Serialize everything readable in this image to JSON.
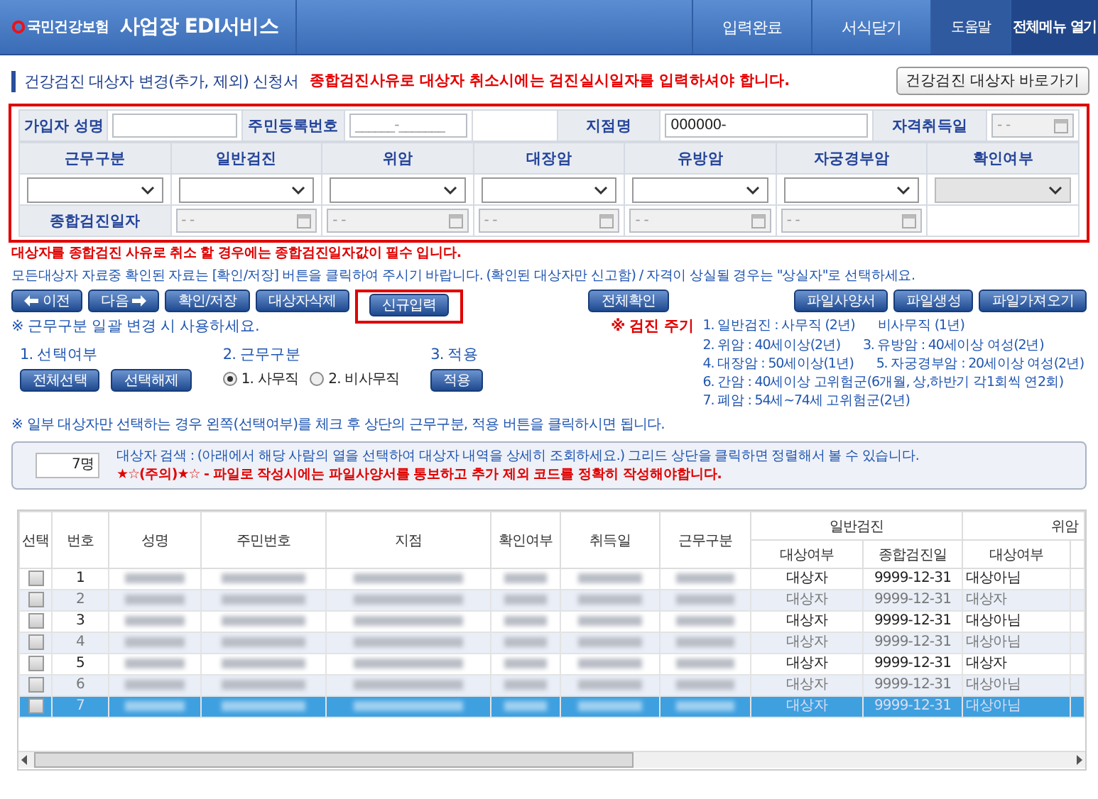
{
  "header": {
    "logo_text": "국민건강보험",
    "title": "사업장 EDI서비스",
    "menu": [
      {
        "label": "입력완료",
        "kind": "main"
      },
      {
        "label": "서식닫기",
        "kind": "main"
      },
      {
        "label": "도움말",
        "kind": "help"
      },
      {
        "label": "전체메뉴 열기",
        "kind": "all"
      }
    ]
  },
  "page": {
    "title": "건강검진 대상자 변경(추가, 제외) 신청서",
    "warning": "종합검진사유로 대상자 취소시에는 검진실시일자를 입력하셔야 합니다.",
    "shortcut_button": "건강검진 대상자 바로가기"
  },
  "form": {
    "fields": [
      {
        "label": "가입자 성명",
        "kind": "text"
      },
      {
        "label": "주민등록번호",
        "kind": "text",
        "placeholder": "______-_______"
      },
      {
        "label": "지점명",
        "kind": "text",
        "value": "000000-"
      },
      {
        "label": "자격취득일",
        "kind": "date",
        "placeholder": "- -",
        "disabled": true
      }
    ],
    "columns": [
      {
        "label": "근무구분",
        "disabled": false
      },
      {
        "label": "일반검진",
        "disabled": false
      },
      {
        "label": "위암",
        "disabled": false
      },
      {
        "label": "대장암",
        "disabled": false
      },
      {
        "label": "유방암",
        "disabled": false
      },
      {
        "label": "자궁경부암",
        "disabled": false
      },
      {
        "label": "확인여부",
        "disabled": true
      }
    ],
    "exam_date": {
      "label": "종합검진일자",
      "fields": [
        {
          "placeholder": "- -",
          "disabled": true
        },
        {
          "placeholder": "- -",
          "disabled": true
        },
        {
          "placeholder": "- -",
          "disabled": true
        },
        {
          "placeholder": "- -",
          "disabled": true
        },
        {
          "placeholder": "- -",
          "disabled": true
        }
      ]
    }
  },
  "notices": [
    {
      "kind": "alert",
      "text": "대상자를 종합검진 사유로 취소 할 경우에는 종합검진일자값이 필수 입니다."
    },
    {
      "kind": "info",
      "text": "모든대상자 자료중 확인된 자료는 [확인/저장] 버튼을 클릭하여 주시기 바랍니다. (확인된 대상자만 신고함) / 자격이 상실될 경우는 \"상실자\"로 선택하세요."
    }
  ],
  "toolbar": {
    "left": [
      {
        "label": "이전",
        "kind": "prev",
        "highlighted": false
      },
      {
        "label": "다음",
        "kind": "next",
        "highlighted": false
      },
      {
        "label": "확인/저장",
        "highlighted": false
      },
      {
        "label": "대상자삭제",
        "highlighted": false
      },
      {
        "label": "신규입력",
        "highlighted": true
      }
    ],
    "center": [
      {
        "label": "전체확인"
      }
    ],
    "right": [
      {
        "label": "파일사양서"
      },
      {
        "label": "파일생성"
      },
      {
        "label": "파일가져오기"
      }
    ]
  },
  "batch": {
    "title": "※ 근무구분 일괄 변경 시 사용하세요.",
    "select": {
      "label": "1. 선택여부",
      "buttons": [
        "전체선택",
        "선택해제"
      ]
    },
    "work_type": {
      "label": "2. 근무구분",
      "options": [
        {
          "label": "1. 사무직",
          "selected": true
        },
        {
          "label": "2. 비사무직",
          "selected": false
        }
      ]
    },
    "apply": {
      "label": "3. 적용",
      "button": "적용"
    },
    "note": "※ 일부 대상자만 선택하는 경우 왼쪽(선택여부)를 체크 후 상단의 근무구분, 적용 버튼을 클릭하시면 됩니다."
  },
  "cycle": {
    "title": "※ 검진 주기",
    "lines": [
      [
        "1. 일반검진 : 사무직 (2년)",
        "비사무직 (1년)"
      ],
      [
        "2. 위암 : 40세이상(2년)",
        "3. 유방암 : 40세이상 여성(2년)"
      ],
      [
        "4. 대장암 : 50세이상(1년)",
        "5. 자궁경부암 : 20세이상 여성(2년)"
      ],
      [
        "6. 간암 : 40세이상 고위험군(6개월, 상,하반기 각1회씩 연2회)"
      ],
      [
        "7. 폐암 : 54세~74세 고위험군(2년)"
      ]
    ]
  },
  "search": {
    "count": "7명",
    "description": "대상자 검색 : (아래에서 해당 사람의 열을 선택하여 대상자 내역을 상세히 조회하세요.) 그리드 상단을 클릭하면 정렬해서 볼 수 있습니다.",
    "caution": "★☆(주의)★☆ - 파일로 작성시에는 파일사양서를 통보하고 추가 제외 코드를 정확히 작성해야합니다."
  },
  "grid": {
    "columns": [
      "선택",
      "번호",
      "성명",
      "주민번호",
      "지점",
      "확인여부",
      "취득일",
      "근무구분"
    ],
    "groups": [
      {
        "label": "일반검진",
        "columns": [
          "대상여부",
          "종합검진일"
        ]
      },
      {
        "label": "위암",
        "columns": [
          "대상여부"
        ]
      }
    ],
    "rows": [
      {
        "checked": false,
        "number": "1",
        "dimmed": false,
        "selected": false,
        "general_target": "대상자",
        "general_date": "9999-12-31",
        "stomach_target": "대상아님"
      },
      {
        "checked": false,
        "number": "2",
        "dimmed": true,
        "selected": false,
        "general_target": "대상자",
        "general_date": "9999-12-31",
        "stomach_target": "대상자"
      },
      {
        "checked": false,
        "number": "3",
        "dimmed": false,
        "selected": false,
        "general_target": "대상자",
        "general_date": "9999-12-31",
        "stomach_target": "대상아님"
      },
      {
        "checked": false,
        "number": "4",
        "dimmed": true,
        "selected": false,
        "general_target": "대상자",
        "general_date": "9999-12-31",
        "stomach_target": "대상아님"
      },
      {
        "checked": false,
        "number": "5",
        "dimmed": false,
        "selected": false,
        "general_target": "대상자",
        "general_date": "9999-12-31",
        "stomach_target": "대상자"
      },
      {
        "checked": false,
        "number": "6",
        "dimmed": true,
        "selected": false,
        "general_target": "대상자",
        "general_date": "9999-12-31",
        "stomach_target": "대상아님"
      },
      {
        "checked": false,
        "number": "7",
        "dimmed": false,
        "selected": true,
        "general_target": "대상자",
        "general_date": "9999-12-31",
        "stomach_target": "대상아님"
      }
    ]
  }
}
